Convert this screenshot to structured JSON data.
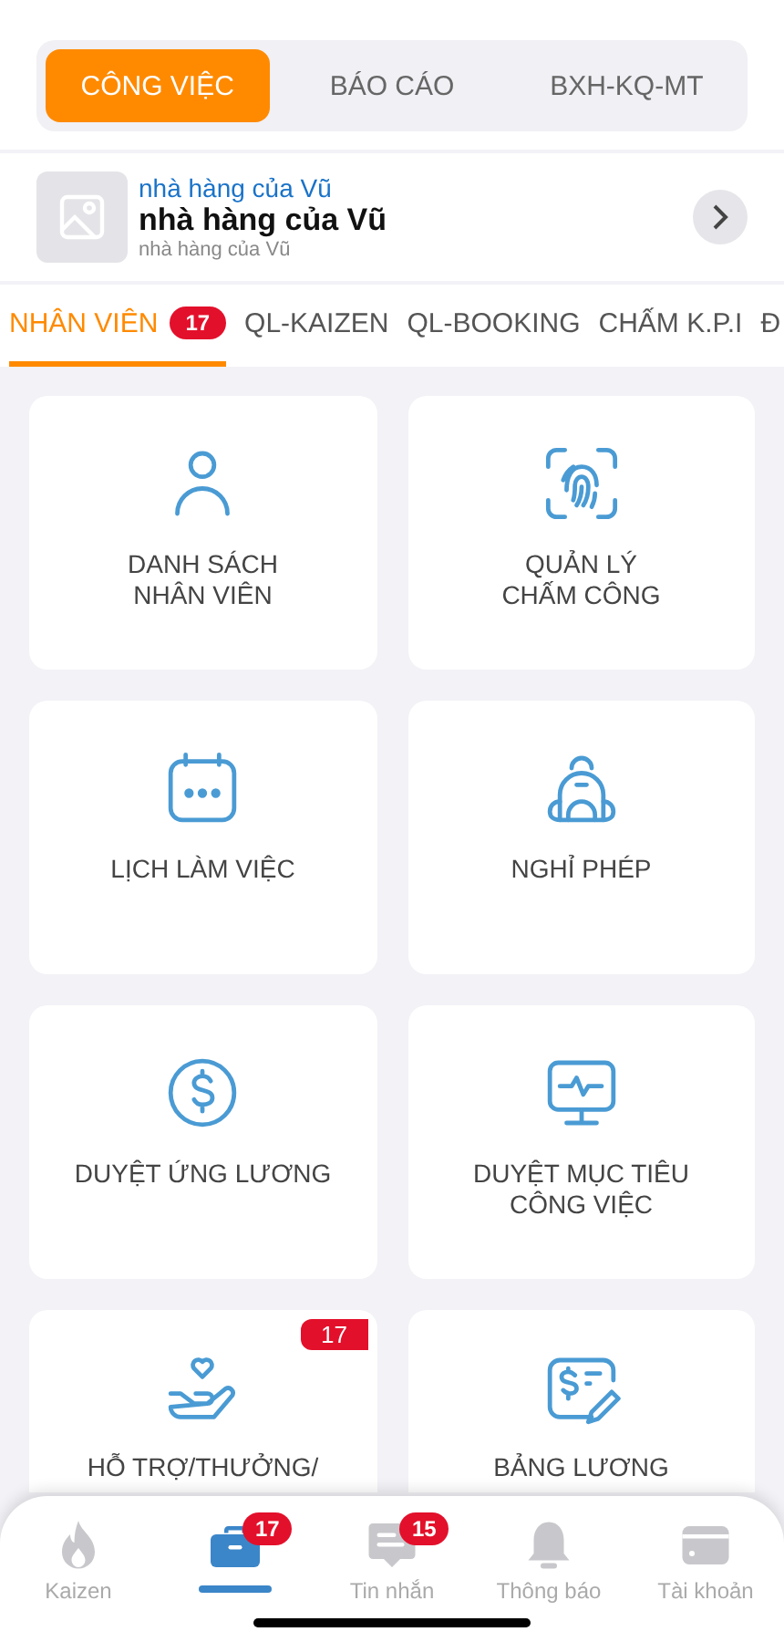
{
  "segments": [
    {
      "label": "CÔNG VIỆC",
      "selected": true
    },
    {
      "label": "BÁO CÁO",
      "selected": false
    },
    {
      "label": "BXH-KQ-MT",
      "selected": false
    }
  ],
  "store": {
    "subtitle": "nhà hàng của Vũ",
    "name": "nhà hàng của Vũ",
    "caption": "nhà hàng của Vũ"
  },
  "tabs": [
    {
      "label": "NHÂN VIÊN",
      "badge": "17",
      "selected": true
    },
    {
      "label": "QL-KAIZEN",
      "selected": false
    },
    {
      "label": "QL-BOOKING",
      "selected": false
    },
    {
      "label": "CHẤM K.P.I",
      "selected": false
    },
    {
      "label": "Đ",
      "selected": false
    }
  ],
  "cards": [
    {
      "kind": "person",
      "label": "DANH SÁCH\nNHÂN VIÊN"
    },
    {
      "kind": "fingerprint",
      "label": "QUẢN LÝ\nCHẤM CÔNG"
    },
    {
      "kind": "calendar",
      "label": "LỊCH LÀM VIỆC"
    },
    {
      "kind": "backpack",
      "label": "NGHỈ PHÉP"
    },
    {
      "kind": "dollar",
      "label": "DUYỆT ỨNG LƯƠNG"
    },
    {
      "kind": "monitor",
      "label": "DUYỆT MỤC TIÊU\nCÔNG VIỆC"
    },
    {
      "kind": "hand",
      "label": "HỖ TRỢ/THƯỞNG/",
      "badge": "17"
    },
    {
      "kind": "payslip",
      "label": "BẢNG LƯƠNG"
    }
  ],
  "bottom_nav": [
    {
      "kind": "flame",
      "label": "Kaizen",
      "selected": false
    },
    {
      "kind": "briefcase",
      "badge": "17",
      "selected": true
    },
    {
      "kind": "chat",
      "label": "Tin nhắn",
      "badge": "15",
      "selected": false
    },
    {
      "kind": "bell",
      "label": "Thông báo",
      "selected": false
    },
    {
      "kind": "wallet",
      "label": "Tài khoản",
      "selected": false
    }
  ]
}
